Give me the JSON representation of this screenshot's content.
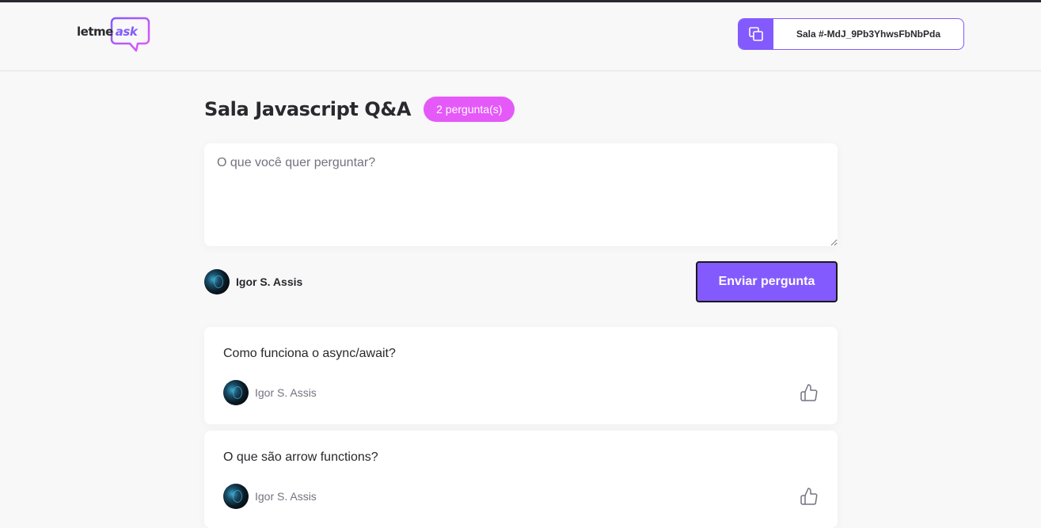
{
  "header": {
    "logo": {
      "text_plain": "letme",
      "text_accent": "ask",
      "icon": "speech-bubble-logo"
    },
    "room_code": {
      "label": "Sala #-MdJ_9Pb3YhwsFbNbPda",
      "icon": "copy-icon"
    }
  },
  "room": {
    "title": "Sala Javascript Q&A",
    "question_count": "2 pergunta(s)"
  },
  "form": {
    "placeholder": "O que você quer perguntar?",
    "value": "",
    "user_name": "Igor S. Assis",
    "submit_label": "Enviar pergunta"
  },
  "questions": [
    {
      "content": "Como funciona o async/await?",
      "author": "Igor S. Assis",
      "like_icon": "thumbs-up-icon"
    },
    {
      "content": "O que são arrow functions?",
      "author": "Igor S. Assis",
      "like_icon": "thumbs-up-icon"
    }
  ],
  "colors": {
    "accent": "#835afd",
    "badge": "#e559f9",
    "text": "#29292e",
    "muted": "#737380",
    "background": "#f8f8f8"
  }
}
